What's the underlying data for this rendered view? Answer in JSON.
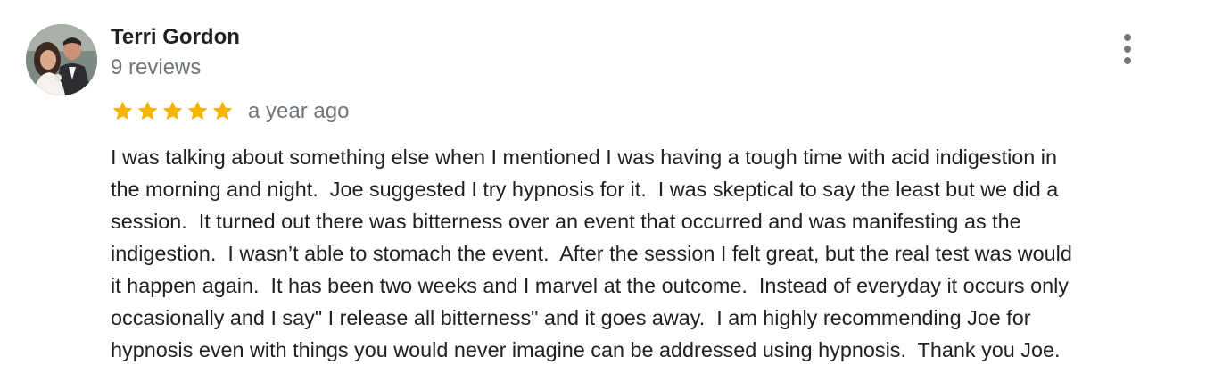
{
  "review": {
    "author_name": "Terri Gordon",
    "review_count": "9 reviews",
    "rating": 5,
    "rating_max": 5,
    "date": "a year ago",
    "star_color": "#f4b400",
    "more_icon": "more-vertical-icon",
    "text_lines": [
      "I was talking about something else when I mentioned I was having a tough time with acid indigestion in",
      "the morning and night.  Joe suggested I try hypnosis for it.  I was skeptical to say the least but we did a",
      "session.  It turned out there was bitterness over an event that occurred and was manifesting as the",
      "indigestion.  I wasn’t able to stomach the event.  After the session I felt great, but the real test was would",
      "it happen again.  It has been two weeks and I marvel at the outcome.  Instead of everyday it occurs only",
      "occasionally and I say\" I release all bitterness\" and it goes away.  I am highly recommending Joe for",
      "hypnosis even with things you would never imagine can be addressed using hypnosis.  Thank you Joe."
    ]
  }
}
